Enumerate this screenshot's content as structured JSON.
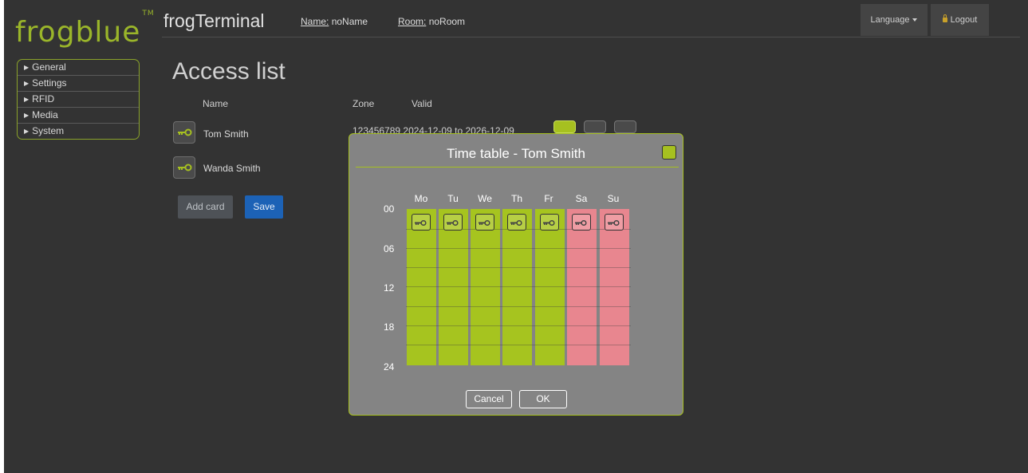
{
  "brand": {
    "logo_text": "frogblue",
    "trademark": "TM"
  },
  "header": {
    "app_title": "frogTerminal",
    "name_key": "Name:",
    "name_value": "noName",
    "room_key": "Room:",
    "room_value": "noRoom",
    "language_label": "Language",
    "logout_label": "Logout"
  },
  "sidebar": {
    "items": [
      {
        "label": "General"
      },
      {
        "label": "Settings"
      },
      {
        "label": "RFID"
      },
      {
        "label": "Media"
      },
      {
        "label": "System"
      }
    ]
  },
  "main": {
    "title": "Access list",
    "columns": {
      "name": "Name",
      "zone": "Zone",
      "valid": "Valid"
    },
    "rows": [
      {
        "name": "Tom Smith",
        "zone_valid_partial": "123456789 2024-12-09 to 2026-12-09"
      },
      {
        "name": "Wanda Smith"
      }
    ],
    "add_card_label": "Add card",
    "save_label": "Save"
  },
  "modal": {
    "title": "Time table - Tom Smith",
    "days": [
      "Mo",
      "Tu",
      "We",
      "Th",
      "Fr",
      "Sa",
      "Su"
    ],
    "hours": [
      "00",
      "06",
      "12",
      "18",
      "24"
    ],
    "cancel_label": "Cancel",
    "ok_label": "OK"
  },
  "colors": {
    "accent": "#a6c020",
    "weekday_fill": "#a6c41f",
    "weekend_fill": "#e8868f",
    "save_blue": "#1c62b6",
    "background": "#333333"
  }
}
